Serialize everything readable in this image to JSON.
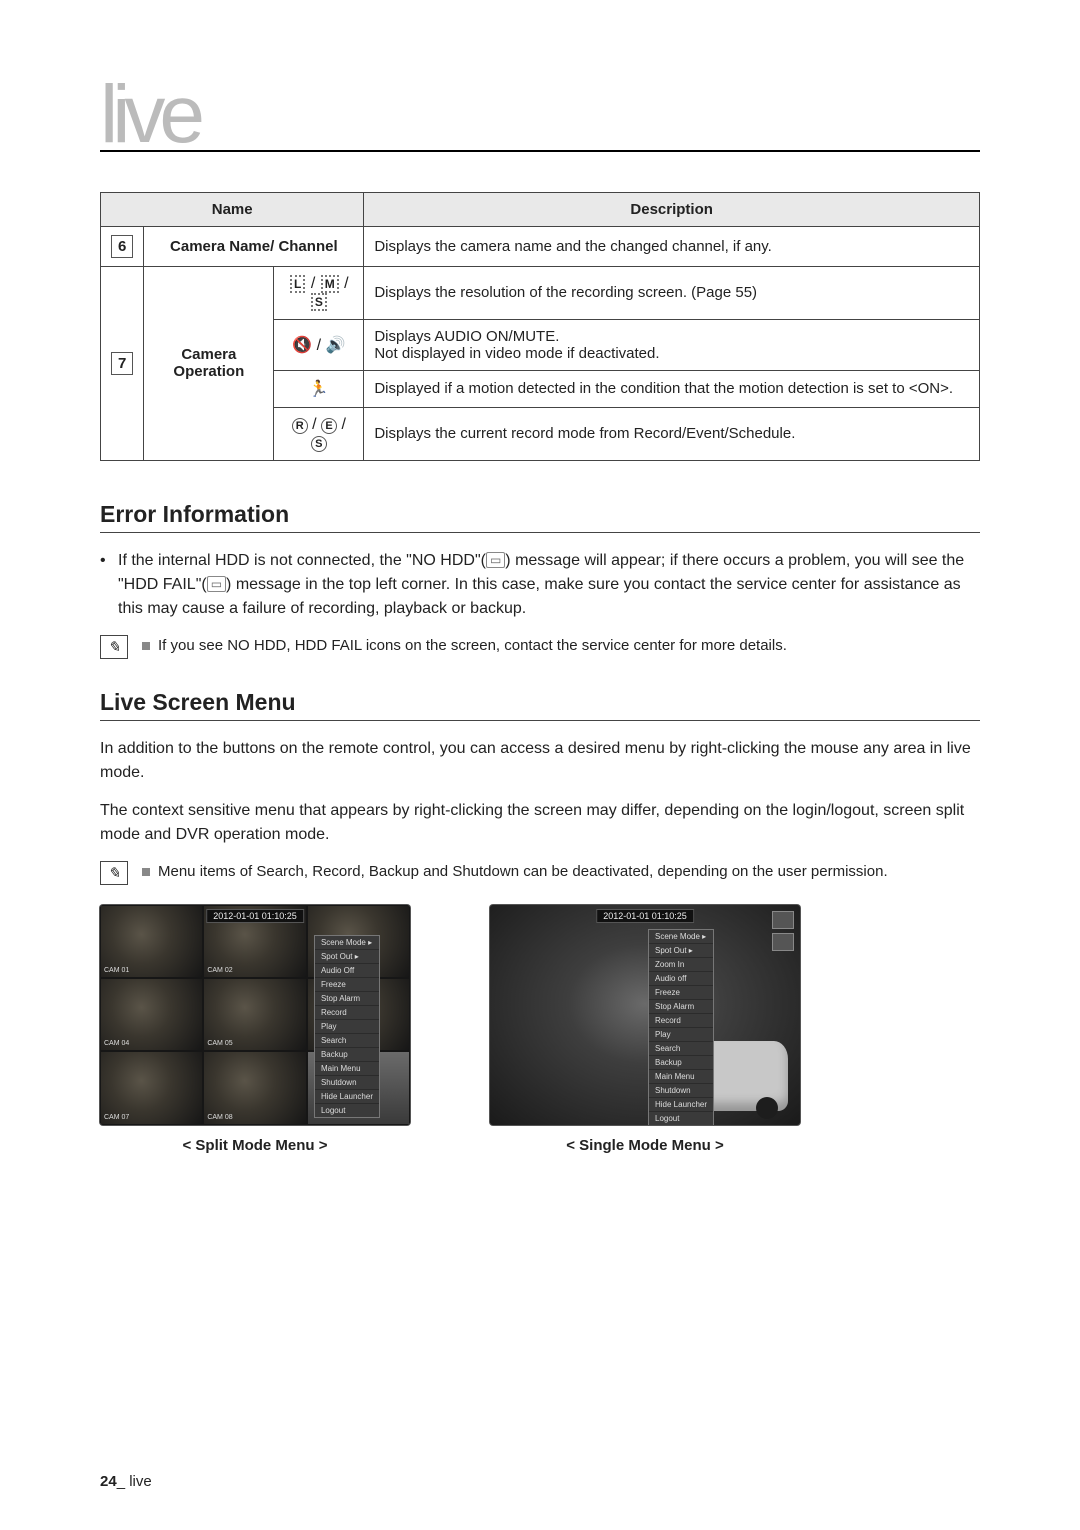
{
  "page_title": "live",
  "table": {
    "head": {
      "name": "Name",
      "description": "Description"
    },
    "row6": {
      "num": "6",
      "name": "Camera Name/ Channel",
      "desc": "Displays the camera name and the changed channel, if any."
    },
    "row7": {
      "num": "7",
      "name": "Camera Operation",
      "sub": [
        {
          "icon": "L M S",
          "desc": "Displays the resolution of the recording screen. (Page 55)"
        },
        {
          "icon": "audio",
          "desc": "Displays AUDIO ON/MUTE.\nNot displayed in video mode if deactivated."
        },
        {
          "icon": "motion",
          "desc": "Displayed if a motion detected in the condition that the motion detection is set to <ON>."
        },
        {
          "icon": "R E S",
          "desc": "Displays the current record mode from Record/Event/Schedule."
        }
      ]
    }
  },
  "error_section": {
    "heading": "Error Information",
    "bullet": "If the internal HDD is not connected, the \"NO HDD\"( ▭ ) message will appear; if there occurs a problem, you will see the \"HDD FAIL\"( ▭ ) message in the top left corner. In this case, make sure you contact the service center for assistance as this may cause a failure of recording, playback or backup.",
    "note": "If you see NO HDD, HDD FAIL icons on the screen, contact the service center for more details."
  },
  "live_menu": {
    "heading": "Live Screen Menu",
    "p1": "In addition to the buttons on the remote control, you can access a desired menu by right-clicking the mouse any area in live mode.",
    "p2": "The context sensitive menu that appears by right-clicking the screen may differ, depending on the login/logout, screen split mode and DVR operation mode.",
    "note": "Menu items of Search, Record, Backup and Shutdown can be deactivated, depending on the user permission.",
    "timestamp": "2012-01-01 01:10:25",
    "split_caption": "< Split Mode Menu >",
    "single_caption": "< Single Mode Menu >",
    "cams": [
      "CAM 01",
      "CAM 02",
      "",
      "CAM 04",
      "CAM 05",
      "",
      "CAM 07",
      "CAM 08",
      ""
    ],
    "menu_split": [
      "Scene Mode  ▸",
      "Spot Out  ▸",
      "Audio Off",
      "Freeze",
      "Stop Alarm",
      "Record",
      "Play",
      "Search",
      "Backup",
      "Main Menu",
      "Shutdown",
      "Hide Launcher",
      "Logout"
    ],
    "menu_single": [
      "Scene Mode  ▸",
      "Spot Out  ▸",
      "Zoom In",
      "Audio off",
      "Freeze",
      "Stop Alarm",
      "Record",
      "Play",
      "Search",
      "Backup",
      "Main Menu",
      "Shutdown",
      "Hide Launcher",
      "Logout"
    ]
  },
  "footer": {
    "page": "24",
    "section": "live"
  }
}
